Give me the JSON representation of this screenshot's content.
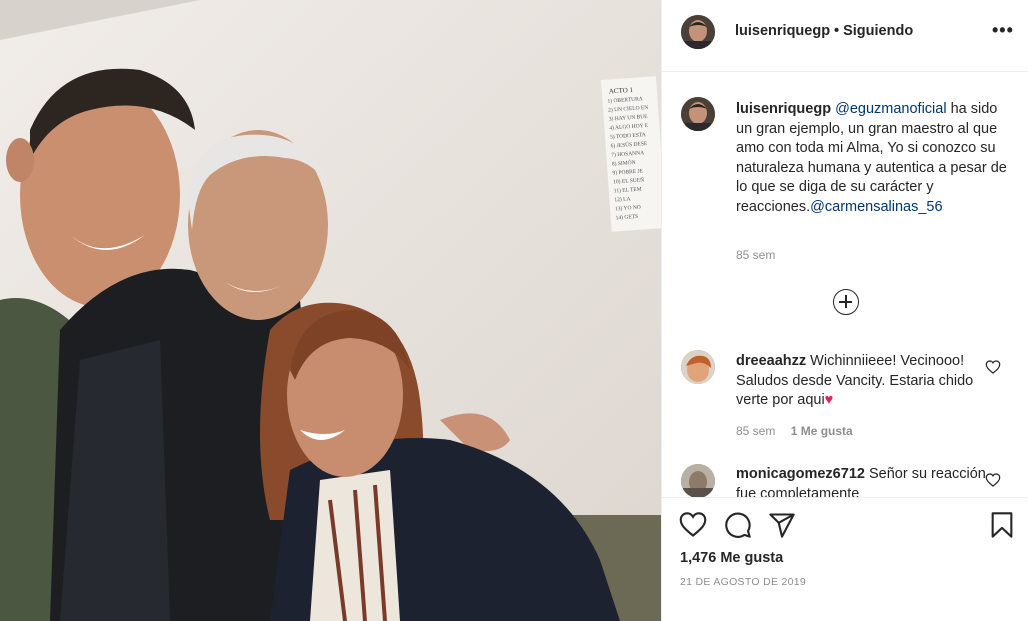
{
  "photo": {
    "description_icon": "photo-image",
    "paper_title": "ACTO 1",
    "paper_lines": [
      "1) OBERTURA",
      "2) UN CIELO EN",
      "3) HAY UN BUE",
      "4) ALGO HOY E",
      "5) TODO ESTA",
      "6) JESÚS DESE",
      "7) HOSANNA",
      "8) SIMÓN",
      "9) POBRE JE",
      "10) EL SUEÑ",
      "11) EL TEM",
      "12) LA",
      "13) YO NO",
      "14) GETS",
      "15) EDO",
      "16) LOS"
    ]
  },
  "header": {
    "username": "luisenriquegp",
    "follow_status": "• Siguiendo",
    "more_icon": "more-options-icon",
    "more_label": "•••"
  },
  "caption": {
    "username": "luisenriquegp",
    "mention1": "@eguzmanoficial",
    "text": " ha sido un gran ejemplo, un gran maestro al que amo con toda mi Alma, Yo si conozco su naturaleza humana y autentica a pesar de lo que se diga de su carácter y reacciones.",
    "mention2": "@carmensalinas_56",
    "time": "85 sem"
  },
  "comments": [
    {
      "username": "dreeaahzz",
      "text": "Wichinniieee! Vecinooo! Saludos desde Vancity. Estaria chido verte por aqui",
      "emoji": "♥",
      "time": "85 sem",
      "likes": "1 Me gusta"
    },
    {
      "username": "monicagomez6712",
      "text": "Señor su reacción fue completamente"
    }
  ],
  "actions": {
    "likes_count": "1,476 Me gusta",
    "date": "21 DE AGOSTO DE 2019"
  },
  "colors": {
    "link": "#00376b",
    "muted": "#8e8e8e",
    "text": "#262626",
    "border": "#efefef"
  }
}
